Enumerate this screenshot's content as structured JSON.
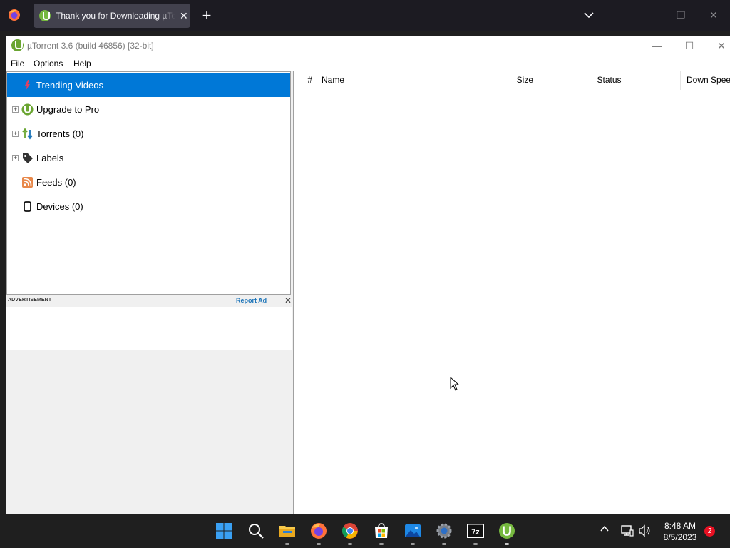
{
  "browser": {
    "tab_title": "Thank you for Downloading µTorrent",
    "tab_close": "✕",
    "new_tab": "+",
    "minimize": "—",
    "restore": "❐",
    "close": "✕"
  },
  "window": {
    "title": "µTorrent 3.6  (build 46856) [32-bit]",
    "minimize": "—",
    "maximize": "☐",
    "close": "✕"
  },
  "menu": {
    "items": [
      "File",
      "Options",
      "Help"
    ]
  },
  "sidebar": {
    "items": [
      {
        "label": "Trending Videos",
        "icon": "trending-icon",
        "selected": true,
        "expandable": false
      },
      {
        "label": "Upgrade to Pro",
        "icon": "utorrent-logo-icon",
        "selected": false,
        "expandable": true
      },
      {
        "label": "Torrents (0)",
        "icon": "transfer-arrows-icon",
        "selected": false,
        "expandable": true
      },
      {
        "label": "Labels",
        "icon": "tag-icon",
        "selected": false,
        "expandable": true
      },
      {
        "label": "Feeds (0)",
        "icon": "rss-icon",
        "selected": false,
        "expandable": false
      },
      {
        "label": "Devices (0)",
        "icon": "device-icon",
        "selected": false,
        "expandable": false
      }
    ]
  },
  "ad": {
    "label": "ADVERTISEMENT",
    "report": "Report Ad",
    "close": "✕"
  },
  "list": {
    "columns": [
      "#",
      "Name",
      "Size",
      "Status",
      "Down Speed"
    ]
  },
  "taskbar": {
    "time": "8:48 AM",
    "date": "8/5/2023",
    "notifications": "2",
    "tray_chevron": "^"
  },
  "colors": {
    "selection": "#0078d7",
    "utorrent_green": "#6aa531",
    "report_link": "#1a73b8"
  }
}
